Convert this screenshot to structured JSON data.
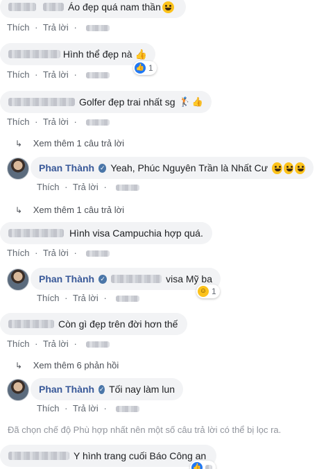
{
  "labels": {
    "like": "Thích",
    "reply": "Trả lời",
    "dot": "·"
  },
  "comments": [
    {
      "text": "Áo đẹp quá nam thần"
    },
    {
      "text": "Hình thể đẹp nà",
      "reaction_count": "1"
    },
    {
      "text": "Golfer đẹp trai nhất sg"
    },
    {
      "text": "Hình visa Campuchia hợp quá."
    },
    {
      "text": "Còn gì đẹp trên đời hơn thế"
    },
    {
      "text": "Y hình trang cuối Báo Công an"
    }
  ],
  "more_replies": [
    {
      "label": "Xem thêm 1 câu trả lời"
    },
    {
      "label": "Xem thêm 1 câu trả lời"
    },
    {
      "label": "Xem thêm 6 phản hồi"
    }
  ],
  "replies": [
    {
      "author": "Phan Thành",
      "text": "Yeah, Phúc Nguyên Trần là Nhất Cư"
    },
    {
      "author": "Phan Thành",
      "text": "visa Mỹ ba",
      "reaction_count": "1"
    },
    {
      "author": "Phan Thành",
      "text": "Tối nay làm lun"
    }
  ],
  "notice": "Đã chọn chế độ Phù hợp nhất nên một số câu trả lời có thể bị lọc ra.",
  "colors": {
    "link": "#385898",
    "bubble": "#f2f3f5",
    "meta": "#606770",
    "like_blue": "#2078f4"
  }
}
